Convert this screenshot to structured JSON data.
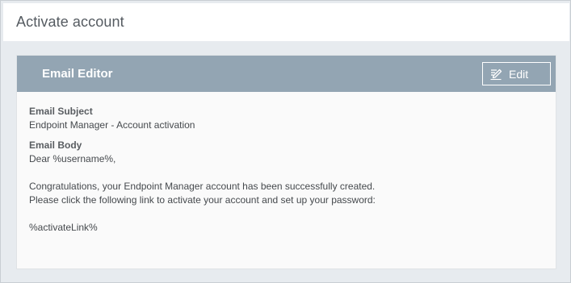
{
  "page": {
    "title": "Activate account"
  },
  "editor": {
    "title": "Email Editor",
    "edit_label": "Edit",
    "edit_icon": "edit-pencil-icon",
    "subject_label": "Email Subject",
    "subject_value": "Endpoint Manager - Account activation",
    "body_label": "Email Body",
    "body_lines": [
      "Dear %username%,",
      "",
      "Congratulations, your Endpoint Manager account has been successfully created.",
      "Please click the following link to activate your account and set up your password:",
      "",
      "%activateLink%"
    ]
  },
  "colors": {
    "header_bg": "#93a5b3",
    "page_bg": "#e7ebef",
    "panel_bg": "#fafafa",
    "title_text": "#555b61"
  }
}
